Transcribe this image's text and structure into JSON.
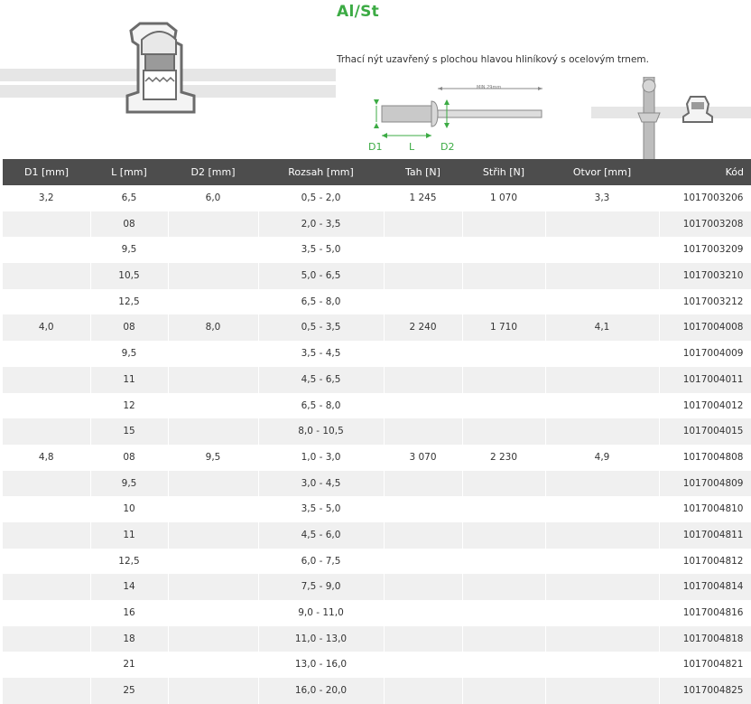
{
  "header": {
    "title": "Al/St",
    "description": "Trhací nýt uzavřený s plochou hlavou hliníkový s ocelovým trnem.",
    "diagram_labels": {
      "d1": "D1",
      "l": "L",
      "d2": "D2",
      "min": "MIN 29mm"
    }
  },
  "colors": {
    "accent": "#3cab44",
    "header_bg": "#4d4d4d",
    "row_alt": "#f0f0f0"
  },
  "table": {
    "columns": [
      "D1 [mm]",
      "L [mm]",
      "D2 [mm]",
      "Rozsah [mm]",
      "Tah [N]",
      "Střih [N]",
      "Otvor [mm]",
      "Kód"
    ],
    "rows": [
      {
        "d1": "3,2",
        "l": "6,5",
        "d2": "6,0",
        "rozsah": "0,5 - 2,0",
        "tah": "1 245",
        "strih": "1 070",
        "otvor": "3,3",
        "kod": "1017003206"
      },
      {
        "d1": "",
        "l": "08",
        "d2": "",
        "rozsah": "2,0 - 3,5",
        "tah": "",
        "strih": "",
        "otvor": "",
        "kod": "1017003208"
      },
      {
        "d1": "",
        "l": "9,5",
        "d2": "",
        "rozsah": "3,5 - 5,0",
        "tah": "",
        "strih": "",
        "otvor": "",
        "kod": "1017003209"
      },
      {
        "d1": "",
        "l": "10,5",
        "d2": "",
        "rozsah": "5,0 - 6,5",
        "tah": "",
        "strih": "",
        "otvor": "",
        "kod": "1017003210"
      },
      {
        "d1": "",
        "l": "12,5",
        "d2": "",
        "rozsah": "6,5 - 8,0",
        "tah": "",
        "strih": "",
        "otvor": "",
        "kod": "1017003212"
      },
      {
        "d1": "4,0",
        "l": "08",
        "d2": "8,0",
        "rozsah": "0,5 - 3,5",
        "tah": "2 240",
        "strih": "1 710",
        "otvor": "4,1",
        "kod": "1017004008"
      },
      {
        "d1": "",
        "l": "9,5",
        "d2": "",
        "rozsah": "3,5 - 4,5",
        "tah": "",
        "strih": "",
        "otvor": "",
        "kod": "1017004009"
      },
      {
        "d1": "",
        "l": "11",
        "d2": "",
        "rozsah": "4,5 - 6,5",
        "tah": "",
        "strih": "",
        "otvor": "",
        "kod": "1017004011"
      },
      {
        "d1": "",
        "l": "12",
        "d2": "",
        "rozsah": "6,5 - 8,0",
        "tah": "",
        "strih": "",
        "otvor": "",
        "kod": "1017004012"
      },
      {
        "d1": "",
        "l": "15",
        "d2": "",
        "rozsah": "8,0 - 10,5",
        "tah": "",
        "strih": "",
        "otvor": "",
        "kod": "1017004015"
      },
      {
        "d1": "4,8",
        "l": "08",
        "d2": "9,5",
        "rozsah": "1,0 - 3,0",
        "tah": "3 070",
        "strih": "2 230",
        "otvor": "4,9",
        "kod": "1017004808"
      },
      {
        "d1": "",
        "l": "9,5",
        "d2": "",
        "rozsah": "3,0 - 4,5",
        "tah": "",
        "strih": "",
        "otvor": "",
        "kod": "1017004809"
      },
      {
        "d1": "",
        "l": "10",
        "d2": "",
        "rozsah": "3,5 - 5,0",
        "tah": "",
        "strih": "",
        "otvor": "",
        "kod": "1017004810"
      },
      {
        "d1": "",
        "l": "11",
        "d2": "",
        "rozsah": "4,5 - 6,0",
        "tah": "",
        "strih": "",
        "otvor": "",
        "kod": "1017004811"
      },
      {
        "d1": "",
        "l": "12,5",
        "d2": "",
        "rozsah": "6,0 - 7,5",
        "tah": "",
        "strih": "",
        "otvor": "",
        "kod": "1017004812"
      },
      {
        "d1": "",
        "l": "14",
        "d2": "",
        "rozsah": "7,5 - 9,0",
        "tah": "",
        "strih": "",
        "otvor": "",
        "kod": "1017004814"
      },
      {
        "d1": "",
        "l": "16",
        "d2": "",
        "rozsah": "9,0 - 11,0",
        "tah": "",
        "strih": "",
        "otvor": "",
        "kod": "1017004816"
      },
      {
        "d1": "",
        "l": "18",
        "d2": "",
        "rozsah": "11,0 - 13,0",
        "tah": "",
        "strih": "",
        "otvor": "",
        "kod": "1017004818"
      },
      {
        "d1": "",
        "l": "21",
        "d2": "",
        "rozsah": "13,0 - 16,0",
        "tah": "",
        "strih": "",
        "otvor": "",
        "kod": "1017004821"
      },
      {
        "d1": "",
        "l": "25",
        "d2": "",
        "rozsah": "16,0 - 20,0",
        "tah": "",
        "strih": "",
        "otvor": "",
        "kod": "1017004825"
      }
    ]
  }
}
